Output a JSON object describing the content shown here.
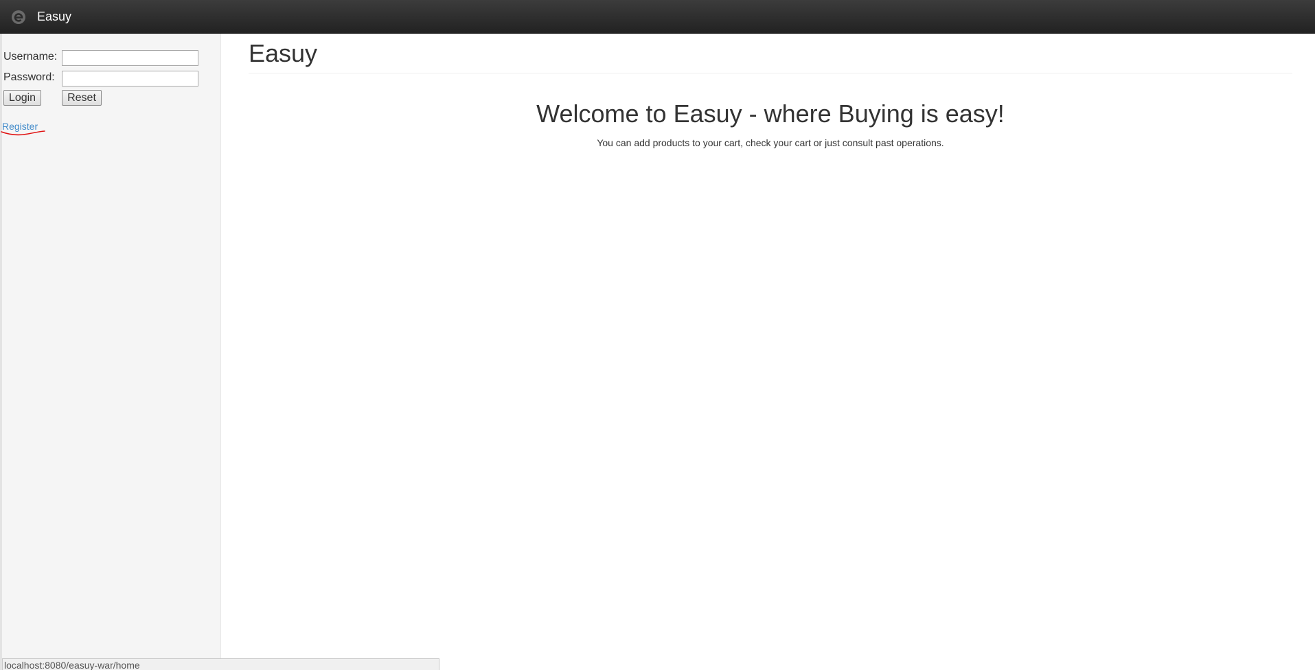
{
  "navbar": {
    "brand_name": "Easuy",
    "logo_icon": "easuy-logo-icon"
  },
  "login_form": {
    "username_label": "Username:",
    "username_value": "",
    "password_label": "Password:",
    "password_value": "",
    "login_label": "Login",
    "reset_label": "Reset"
  },
  "sidebar": {
    "register_link": "Register"
  },
  "main": {
    "page_title": "Easuy",
    "welcome_heading": "Welcome to Easuy - where Buying is easy!",
    "welcome_text": "You can add products to your cart, check your cart or just consult past operations."
  },
  "status_bar": {
    "url": "localhost:8080/easuy-war/home"
  },
  "colors": {
    "navbar_bg": "#222222",
    "link": "#428bca",
    "annotation_underline": "#e01010"
  }
}
